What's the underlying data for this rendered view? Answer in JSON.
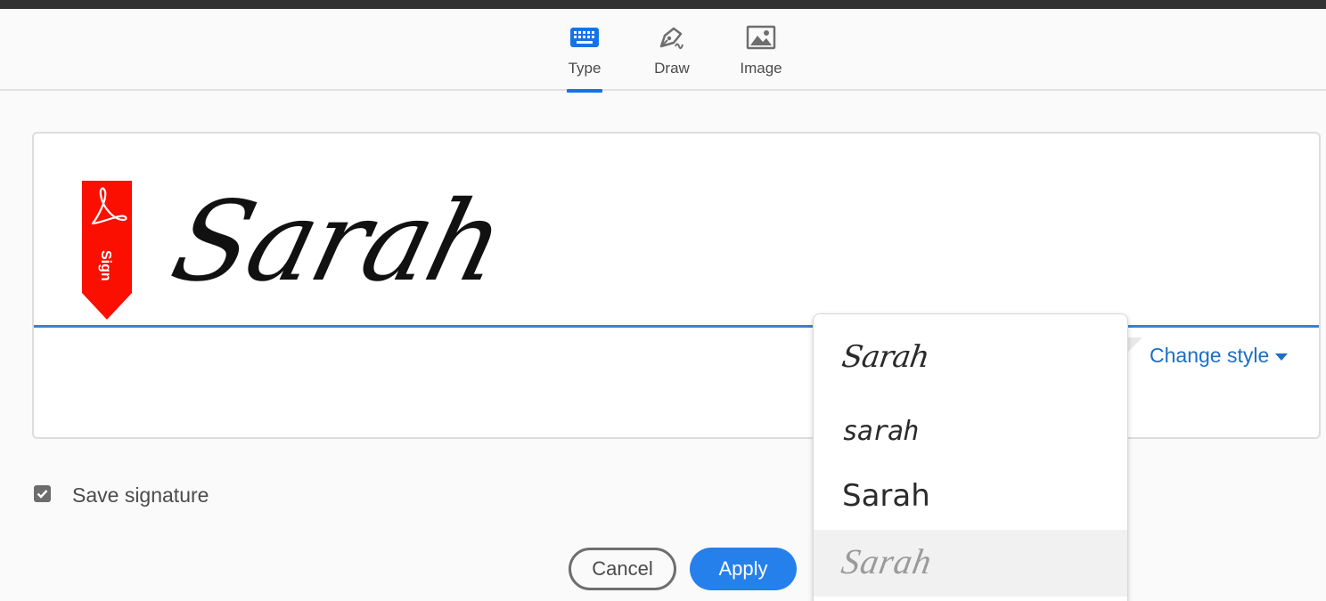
{
  "tabs": [
    {
      "label": "Type",
      "icon": "keyboard-icon",
      "active": true
    },
    {
      "label": "Draw",
      "icon": "pen-icon",
      "active": false
    },
    {
      "label": "Image",
      "icon": "image-icon",
      "active": false
    }
  ],
  "badge": {
    "label": "Sign",
    "color": "#fa0f00"
  },
  "signature": {
    "text": "Sarah"
  },
  "change_style": {
    "label": "Change style"
  },
  "style_options": [
    {
      "text": "Sarah"
    },
    {
      "text": "sarah"
    },
    {
      "text": "Sarah"
    },
    {
      "text": "Sarah"
    }
  ],
  "save_signature": {
    "label": "Save signature",
    "checked": true
  },
  "buttons": {
    "cancel": "Cancel",
    "apply": "Apply"
  },
  "colors": {
    "accent": "#1473e6",
    "apply": "#2680eb",
    "link": "#1b6fc5",
    "badge": "#fa0f00"
  }
}
